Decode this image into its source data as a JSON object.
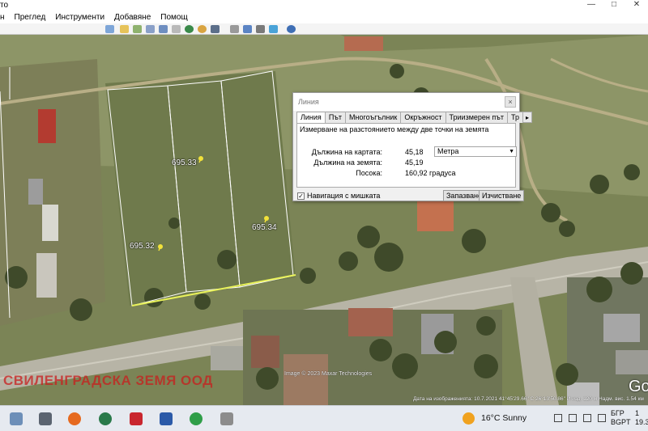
{
  "window": {
    "title": "то"
  },
  "menu": [
    "н",
    "Преглед",
    "Инструменти",
    "Добавяне",
    "Помощ"
  ],
  "map": {
    "parcels": [
      {
        "label": "695.33"
      },
      {
        "label": "695.34"
      },
      {
        "label": "695.32"
      }
    ],
    "watermark": "СВИЛЕНГРАДСКА ЗЕМЯ ООД",
    "copyright": "Image © 2023 Maxar Technologies",
    "google_logo": "Go",
    "status_line": "Дата на изображенията: 10.7.2021   41°45'29.66\" С   26°13'50.86\" И   изд.   120 м   Надм. вис. 1.54 км"
  },
  "dialog": {
    "title": "Линия",
    "close": "×",
    "tabs": [
      "Линия",
      "Път",
      "Многоъгълник",
      "Окръжност",
      "Триизмерен път",
      "Тр"
    ],
    "tab_more": "▸",
    "description": "Измерване на разстоянието между две точки на земята",
    "map_length_label": "Дължина на картата:",
    "map_length_value": "45,18",
    "unit": "Метра",
    "ground_length_label": "Дължина на земята:",
    "ground_length_value": "45,19",
    "heading_label": "Посока:",
    "heading_value": "160,92 градуса",
    "mouse_nav_label": "Навигация с мишката",
    "save_button": "Запазване",
    "clear_button": "Изчистване"
  },
  "taskbar": {
    "weather": "16°C  Sunny",
    "lang_line1": "БГР",
    "lang_line2": "BGPT",
    "clock_line1": "1",
    "clock_line2": "19.3"
  }
}
